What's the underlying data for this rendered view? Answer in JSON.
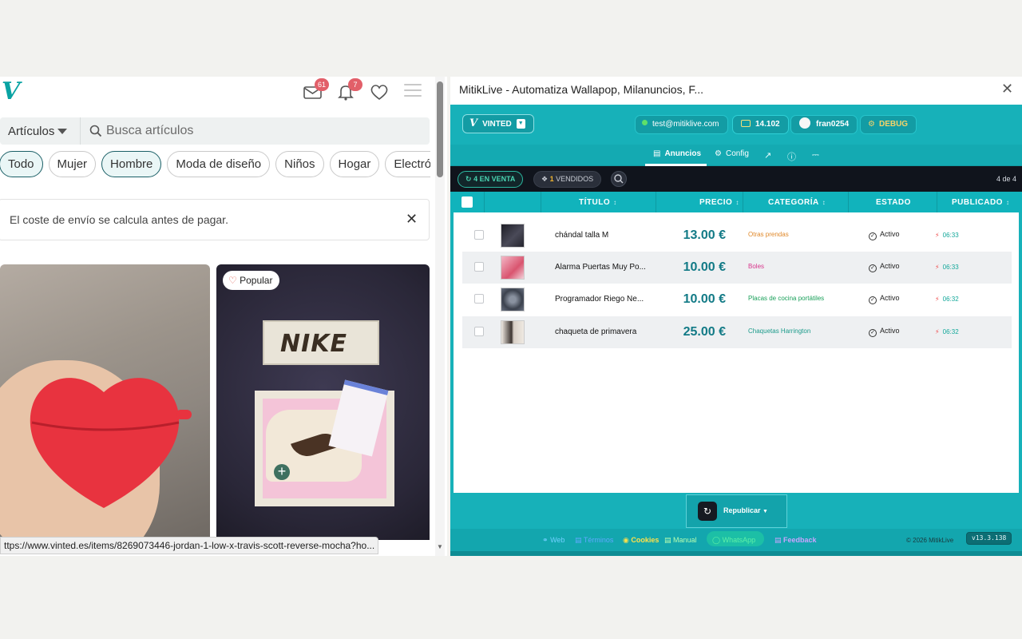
{
  "vinted": {
    "logo": "V",
    "inbox_badge": "61",
    "notif_badge": "7",
    "category_label": "Artículos",
    "search_placeholder": "Busca artículos",
    "chips": [
      "Todo",
      "Mujer",
      "Hombre",
      "Moda de diseño",
      "Niños",
      "Hogar",
      "Electrón"
    ],
    "notice": "El coste de envío se calcula antes de pagar.",
    "popular_label": "Popular",
    "box_brand": "NIKE",
    "status_url": "ttps://www.vinted.es/items/8269073446-jordan-1-low-x-travis-scott-reverse-mocha?ho..."
  },
  "mitik": {
    "window_title": "MitikLive - Automatiza Wallapop, Milanuncios, F...",
    "close_glyph": "✕",
    "platform": "VINTED",
    "email": "test@mitiklive.com",
    "credits": "14.102",
    "username": "fran0254",
    "debug": "DEBUG",
    "tabs": {
      "anuncios": "Anuncios",
      "config": "Config"
    },
    "filters": {
      "on_sale": "4 EN VENTA",
      "sold_count": "1",
      "sold_label": "VENDIDOS"
    },
    "count": "4 de 4",
    "columns": {
      "title": "TÍTULO",
      "price": "PRECIO",
      "category": "CATEGORÍA",
      "state": "ESTADO",
      "published": "PUBLICADO"
    },
    "sort_glyph": "↕",
    "rows": [
      {
        "title": "chándal talla M",
        "price": "13.00 €",
        "category": "Otras prendas",
        "category_color": "#e0892a",
        "state": "Activo",
        "time": "06:33",
        "thumb_color": "#2c2c34"
      },
      {
        "title": "Alarma Puertas Muy Po...",
        "price": "10.00 €",
        "category": "Boles",
        "category_color": "#d8368c",
        "state": "Activo",
        "time": "06:33",
        "thumb_color": "#e48aa0"
      },
      {
        "title": "Programador Riego Ne...",
        "price": "10.00 €",
        "category": "Placas de cocina portátiles",
        "category_color": "#1aa05a",
        "state": "Activo",
        "time": "06:32",
        "thumb_color": "#58606e"
      },
      {
        "title": "chaqueta de primavera",
        "price": "25.00 €",
        "category": "Chaquetas Harrington",
        "category_color": "#1a9a8a",
        "state": "Activo",
        "time": "06:32",
        "thumb_color": "#c8bfb6"
      }
    ],
    "republish": "Republicar",
    "footer": {
      "web": "Web",
      "terms": "Términos",
      "cookies": "Cookies",
      "manual": "Manual",
      "whatsapp": "WhatsApp",
      "feedback": "Feedback",
      "copyright": "© 2026 MitikLive",
      "version": "v13.3.138"
    },
    "colors": {
      "accent": "#17b1b9",
      "dark_bar": "#10141c",
      "price": "#127a86"
    }
  }
}
